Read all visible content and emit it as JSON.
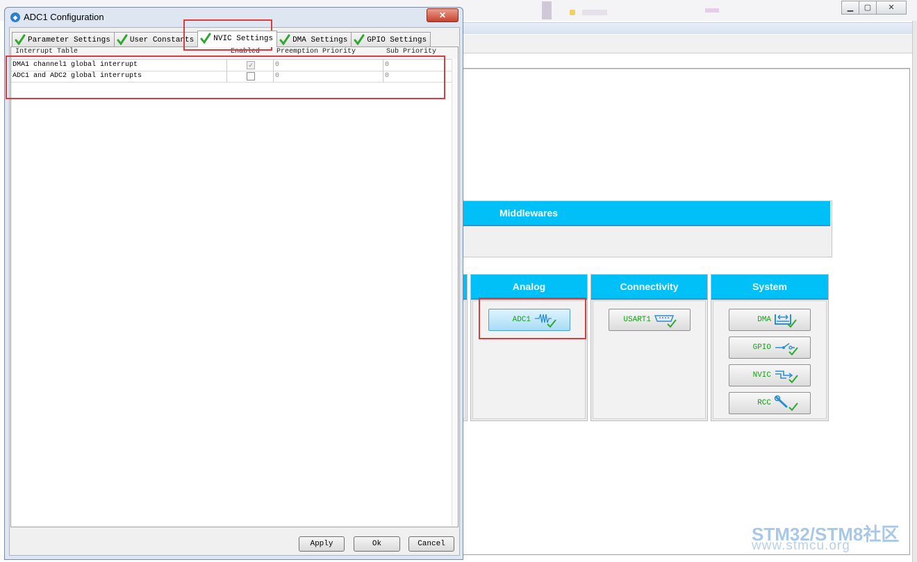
{
  "dialog": {
    "title": "ADC1 Configuration",
    "close_label": "✕",
    "tabs": [
      {
        "label": "Parameter Settings",
        "active": false
      },
      {
        "label": "User Constants",
        "active": false
      },
      {
        "label": "NVIC Settings",
        "active": true
      },
      {
        "label": "DMA Settings",
        "active": false
      },
      {
        "label": "GPIO Settings",
        "active": false
      }
    ],
    "table": {
      "columns": [
        "Interrupt Table",
        "Enabled",
        "Preemption Priority",
        "Sub Priority"
      ],
      "rows": [
        {
          "name": "DMA1 channel1 global interrupt",
          "enabled": true,
          "enabled_disabled": true,
          "preemption": "0",
          "sub": "0"
        },
        {
          "name": "ADC1 and ADC2 global interrupts",
          "enabled": false,
          "enabled_disabled": false,
          "preemption": "0",
          "sub": "0"
        }
      ]
    },
    "buttons": {
      "apply": "Apply",
      "ok": "Ok",
      "cancel": "Cancel"
    }
  },
  "main": {
    "window_controls": [
      "▁",
      "▢",
      "✕"
    ],
    "middlewares": {
      "title": "Middlewares"
    },
    "categories": [
      {
        "title": "Analog",
        "items": [
          {
            "label": "ADC1",
            "icon": "waveform-icon",
            "selected": true
          }
        ]
      },
      {
        "title": "Connectivity",
        "items": [
          {
            "label": "USART1",
            "icon": "serial-port-icon",
            "selected": false
          }
        ]
      },
      {
        "title": "System",
        "items": [
          {
            "label": "DMA",
            "icon": "dma-icon",
            "selected": false
          },
          {
            "label": "GPIO",
            "icon": "switch-icon",
            "selected": false
          },
          {
            "label": "NVIC",
            "icon": "interrupt-icon",
            "selected": false
          },
          {
            "label": "RCC",
            "icon": "wrench-icon",
            "selected": false
          }
        ]
      }
    ]
  },
  "watermark": {
    "line1": "STM32/STM8社区",
    "line2": "www.stmcu.org"
  },
  "colors": {
    "category_header": "#00c0f8",
    "check_green": "#2ea82e",
    "label_green": "#18a018",
    "highlight_red": "#d83c3c"
  }
}
